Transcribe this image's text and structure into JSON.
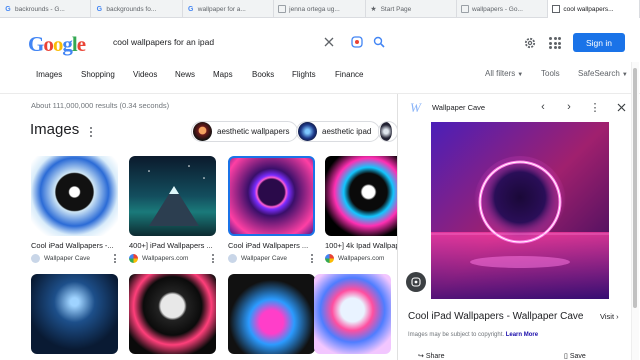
{
  "tabs": [
    {
      "label": "backrounds - G...",
      "favicon": "google-icon",
      "active": false
    },
    {
      "label": "backgrounds fo...",
      "favicon": "google-icon",
      "active": false
    },
    {
      "label": "wallpaper for a...",
      "favicon": "google-icon",
      "active": false
    },
    {
      "label": "jenna ortega ug...",
      "favicon": "page-icon",
      "active": false
    },
    {
      "label": "Start Page",
      "favicon": "star-icon",
      "active": false
    },
    {
      "label": "wallpapers - Go...",
      "favicon": "page-icon",
      "active": false
    },
    {
      "label": "cool wallpapers...",
      "favicon": "page-icon",
      "active": true
    }
  ],
  "header": {
    "logo_letters": [
      "G",
      "o",
      "o",
      "g",
      "l",
      "e"
    ],
    "search_value": "cool wallpapers for an ipad",
    "signin_label": "Sign in"
  },
  "filters": [
    "Images",
    "Shopping",
    "Videos",
    "News",
    "Maps",
    "Books",
    "Flights",
    "Finance"
  ],
  "tools": {
    "all_filters": "All filters",
    "tools": "Tools",
    "safesearch": "SafeSearch"
  },
  "results": {
    "stats": "About 111,000,000 results (0.34 seconds)",
    "section_title": "Images",
    "related": [
      {
        "label": "aesthetic wallpapers"
      },
      {
        "label": "aesthetic ipad"
      }
    ]
  },
  "grid": [
    {
      "caption": "Cool iPad Wallpapers -...",
      "source": "Wallpaper Cave"
    },
    {
      "caption": "400+] iPad Wallpapers ...",
      "source": "Wallpapers.com"
    },
    {
      "caption": "Cool iPad Wallpapers ...",
      "source": "Wallpaper Cave"
    },
    {
      "caption": "100+] 4k Ipad Wallpap...",
      "source": "Wallpapers.com"
    }
  ],
  "preview": {
    "site": "Wallpaper Cave",
    "title": "Cool iPad Wallpapers - Wallpaper Cave",
    "visit_label": "Visit",
    "copyright_text": "Images may be subject to copyright.",
    "learn_more": "Learn More",
    "share_label": "Share",
    "save_label": "Save"
  },
  "colors": {
    "accent": "#1a73e8",
    "background": "#ffffff"
  }
}
